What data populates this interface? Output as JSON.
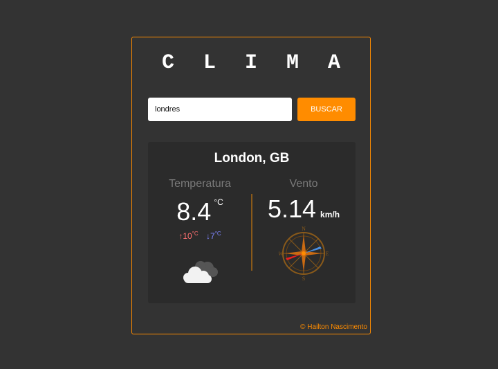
{
  "app": {
    "title": "C L I M A"
  },
  "search": {
    "value": "londres",
    "placeholder": "",
    "button_label": "BUSCAR"
  },
  "result": {
    "city": "London, GB",
    "temperature": {
      "label": "Temperatura",
      "value": "8.4",
      "unit": "°C",
      "max": "10",
      "min": "7",
      "max_arrow": "↑",
      "min_arrow": "↓",
      "minmax_unit": "°C",
      "condition_icon": "cloud-icon"
    },
    "wind": {
      "label": "Vento",
      "value": "5.14",
      "unit": "km/h",
      "compass_icon": "compass-icon",
      "compass_labels": {
        "north": "N",
        "south": "S",
        "east": "E",
        "west": "W"
      }
    }
  },
  "footer": {
    "credit": "© Hailton Nascimento"
  },
  "colors": {
    "background": "#333333",
    "accent": "#ff8c00",
    "panel": "#2b2b2b",
    "max_temp": "#ff7070",
    "min_temp": "#7f86ff"
  }
}
